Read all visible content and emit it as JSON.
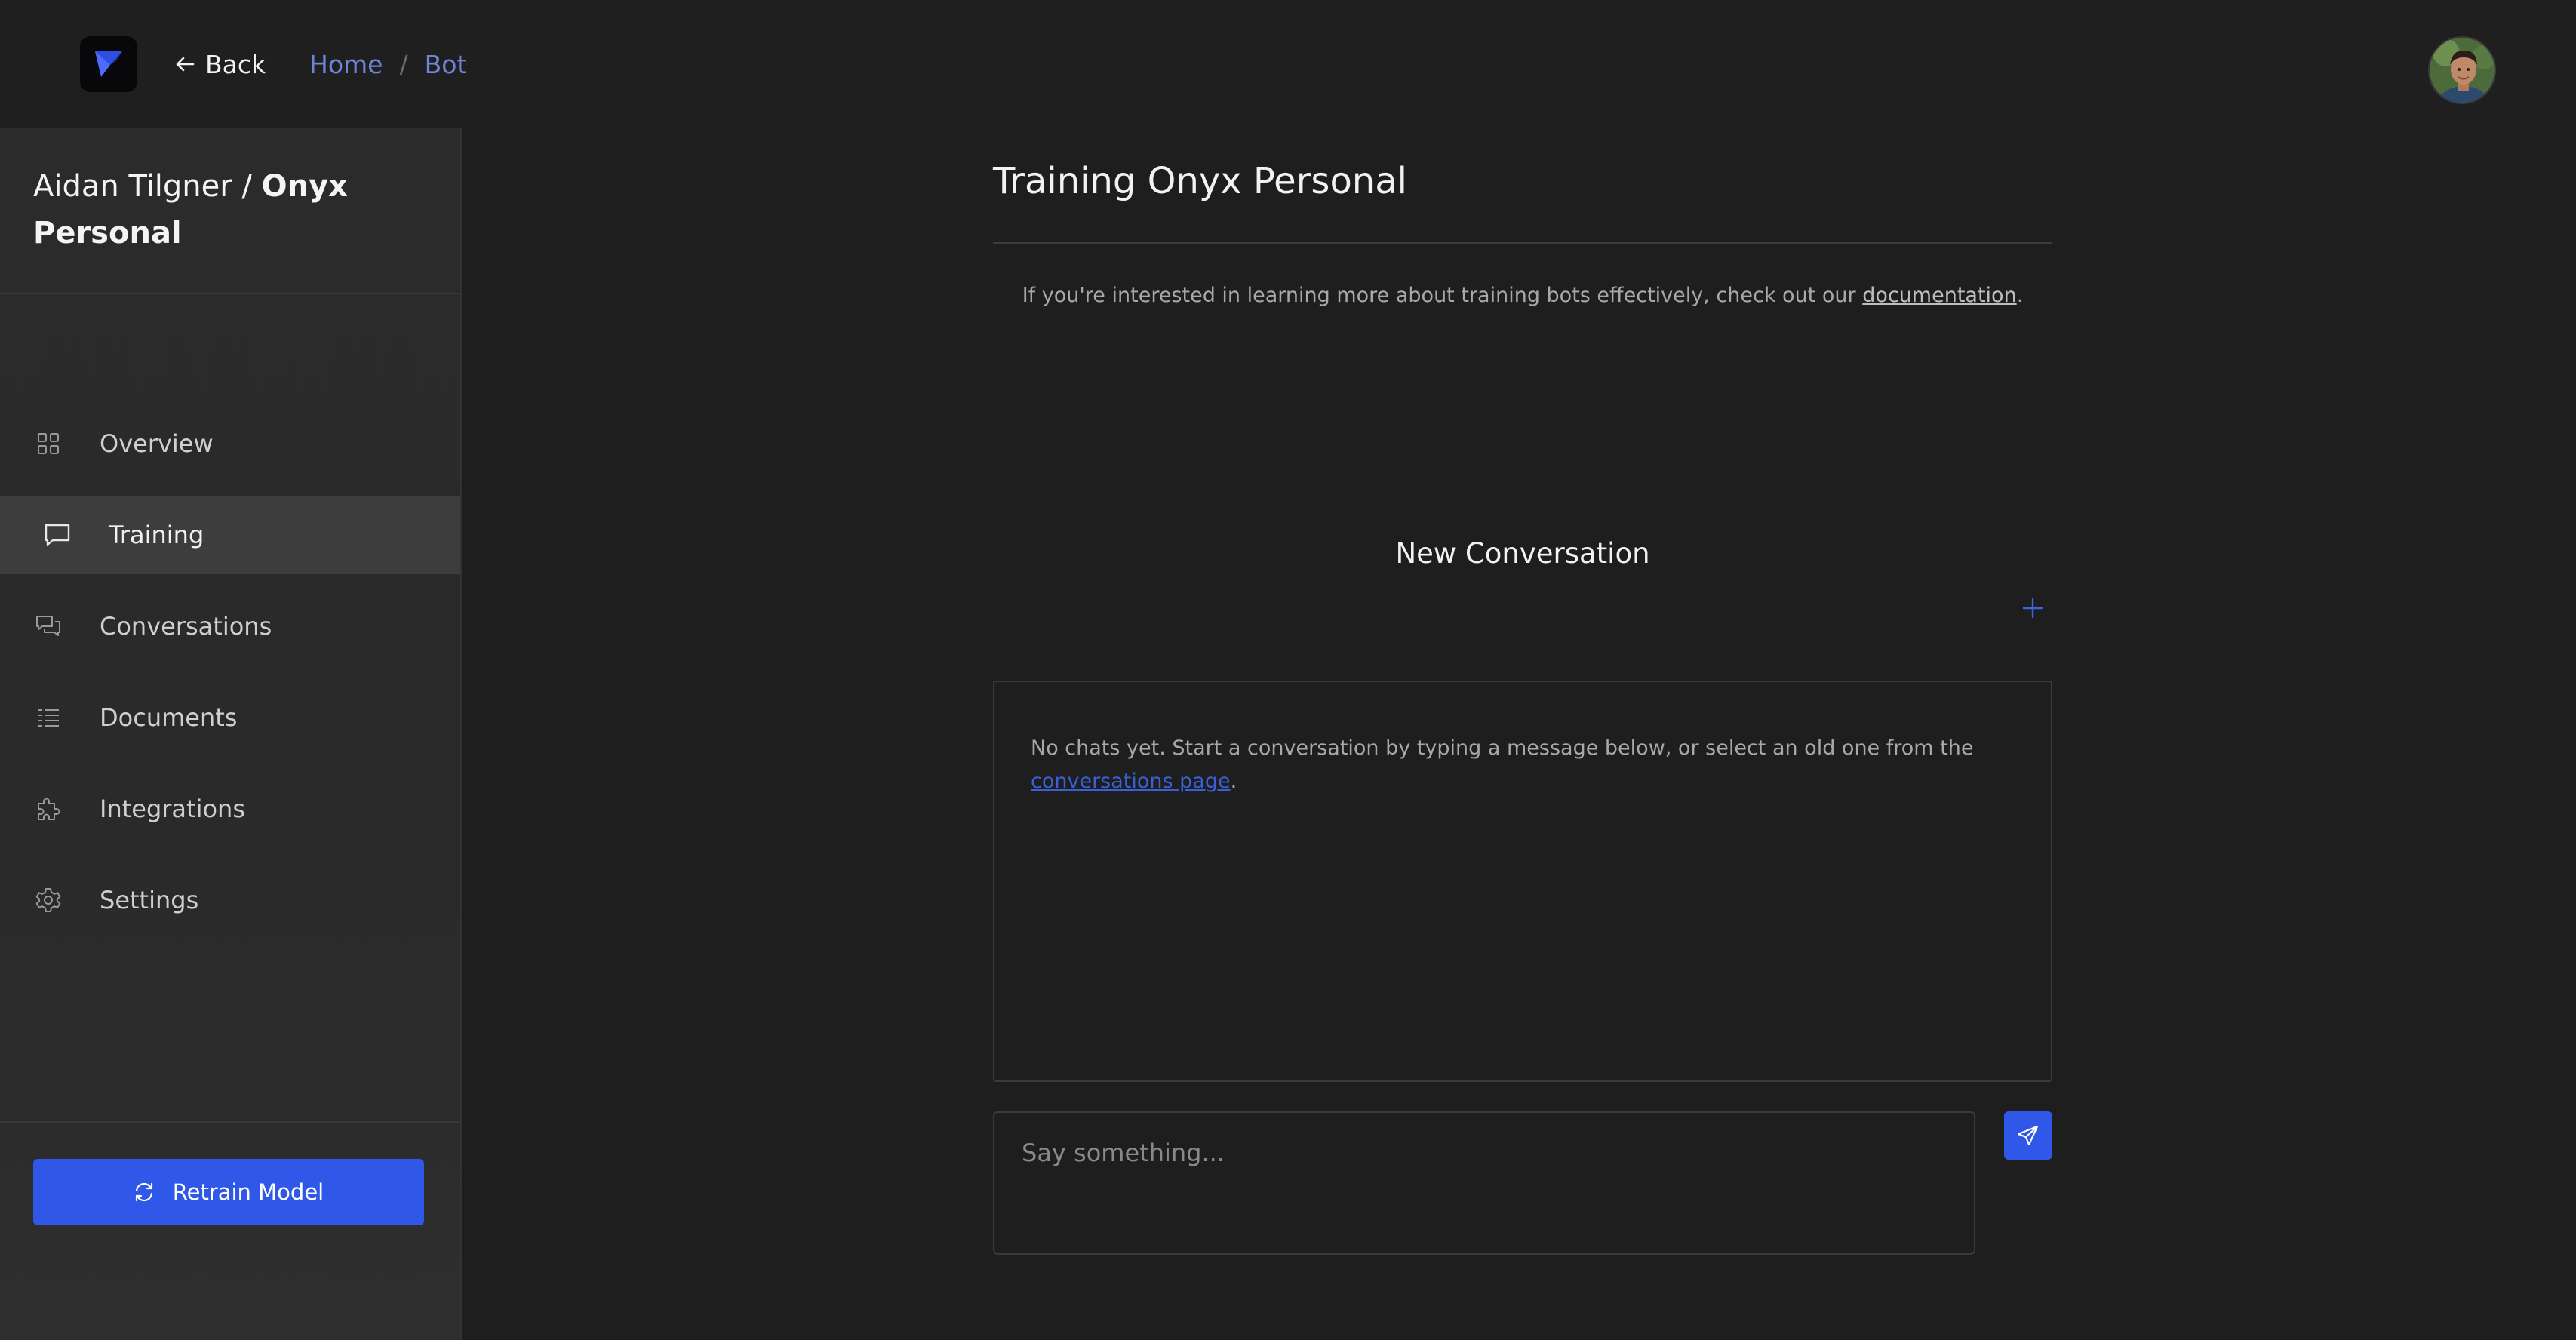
{
  "header": {
    "logo_icon": "brand-logo-icon",
    "back_label": "Back",
    "breadcrumb": [
      "Home",
      "Bot"
    ],
    "breadcrumb_separator": "/"
  },
  "sidebar": {
    "owner": "Aidan Tilgner",
    "title_separator": "/",
    "project": "Onyx Personal",
    "items": [
      {
        "label": "Overview",
        "icon": "grid-icon",
        "active": false
      },
      {
        "label": "Training",
        "icon": "chat-bubble-icon",
        "active": true
      },
      {
        "label": "Conversations",
        "icon": "conversations-icon",
        "active": false
      },
      {
        "label": "Documents",
        "icon": "list-icon",
        "active": false
      },
      {
        "label": "Integrations",
        "icon": "puzzle-icon",
        "active": false
      },
      {
        "label": "Settings",
        "icon": "gear-icon",
        "active": false
      }
    ],
    "retrain_label": "Retrain Model"
  },
  "main": {
    "title": "Training Onyx Personal",
    "info_text": "If you're interested in learning more about training bots effectively, check out our",
    "info_link": "documentation",
    "info_suffix": ".",
    "conversation_heading": "New Conversation",
    "empty_text": "No chats yet. Start a conversation by typing a message below, or select an old one from the",
    "empty_link": "conversations page",
    "empty_suffix": ".",
    "input_placeholder": "Say something...",
    "input_value": ""
  },
  "colors": {
    "background": "#1e1e1e",
    "sidebar": "#2b2b2b",
    "accent": "#2f57e8",
    "link": "#6f86d6"
  }
}
